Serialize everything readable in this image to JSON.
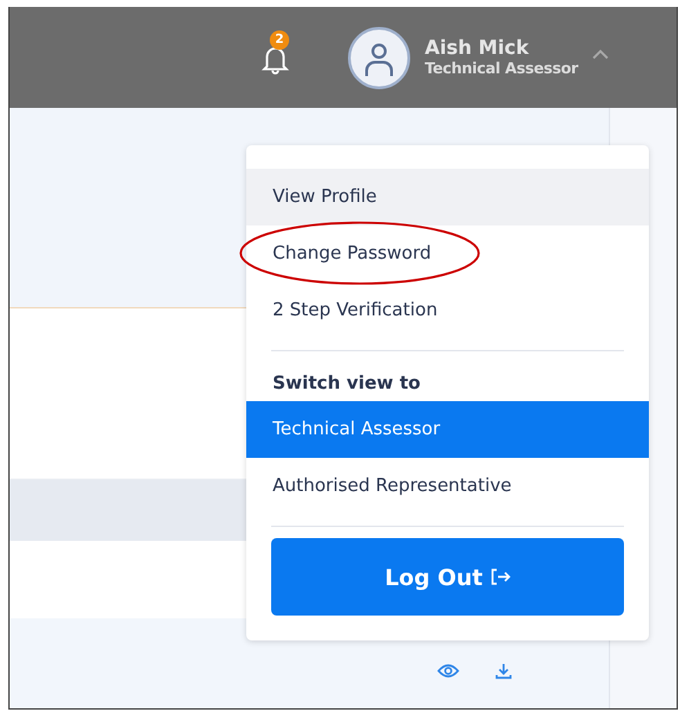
{
  "header": {
    "notification_count": "2",
    "user_name": "Aish Mick",
    "user_role": "Technical Assessor"
  },
  "menu_items": [
    {
      "label": "View Profile",
      "hovered": true
    },
    {
      "label": "Change Password",
      "hovered": false,
      "circled": true
    },
    {
      "label": "2 Step Verification",
      "hovered": false
    }
  ],
  "switch_heading": "Switch view to",
  "roles": [
    {
      "label": "Technical Assessor",
      "selected": true
    },
    {
      "label": "Authorised Representative",
      "selected": false
    }
  ],
  "logout_label": "Log Out"
}
